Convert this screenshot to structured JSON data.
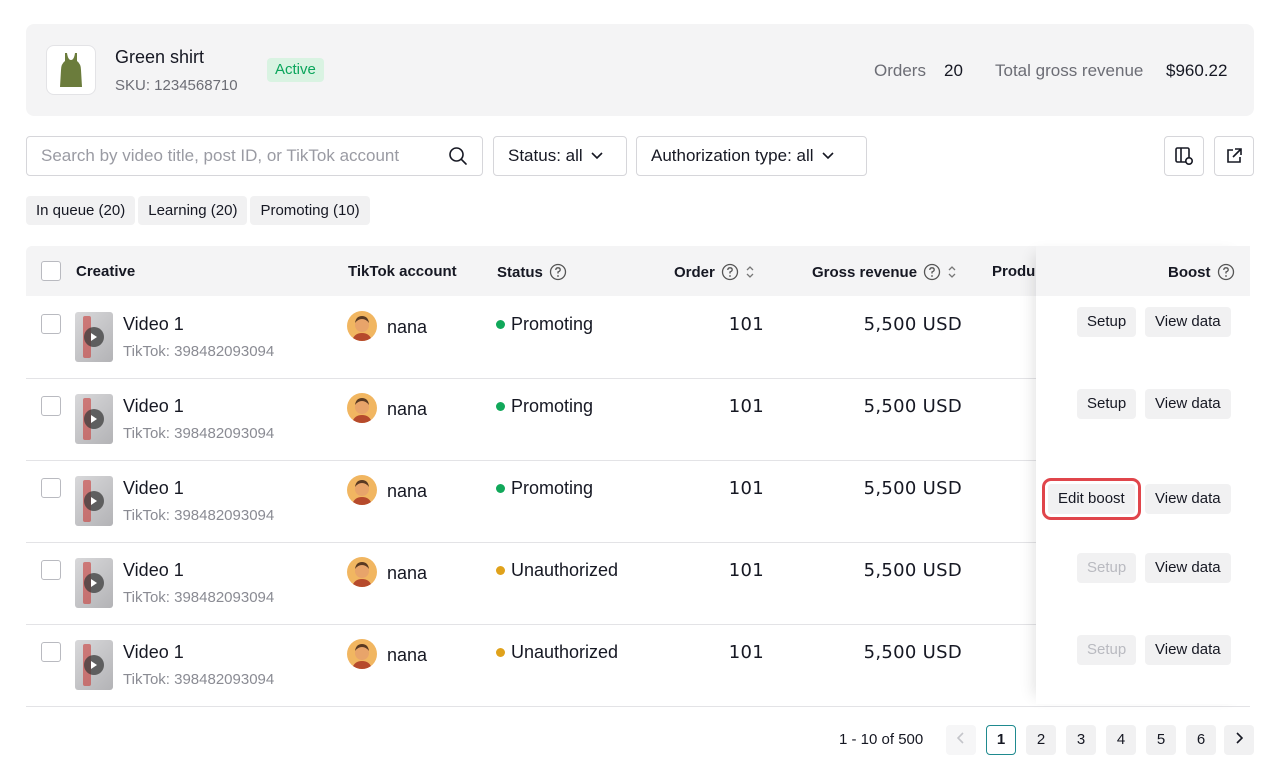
{
  "product": {
    "name": "Green shirt",
    "sku": "SKU: 1234568710",
    "status": "Active",
    "orders_label": "Orders",
    "orders_value": "20",
    "revenue_label": "Total gross revenue",
    "revenue_value": "$960.22"
  },
  "toolbar": {
    "search_placeholder": "Search by video title, post ID, or TikTok account",
    "status_filter": "Status: all",
    "auth_filter": "Authorization type: all"
  },
  "tabs": [
    "In queue (20)",
    "Learning (20)",
    "Promoting (10)"
  ],
  "columns": {
    "creative": "Creative",
    "account": "TikTok account",
    "status": "Status",
    "order": "Order",
    "revenue": "Gross revenue",
    "product": "Produ",
    "boost": "Boost"
  },
  "rows": [
    {
      "title": "Video 1",
      "sub": "TikTok: 398482093094",
      "account": "nana",
      "status": "Promoting",
      "order": "101",
      "revenue": "5,500 USD",
      "boost": "Setup",
      "view": "View data"
    },
    {
      "title": "Video 1",
      "sub": "TikTok: 398482093094",
      "account": "nana",
      "status": "Promoting",
      "order": "101",
      "revenue": "5,500 USD",
      "boost": "Setup",
      "view": "View data"
    },
    {
      "title": "Video 1",
      "sub": "TikTok: 398482093094",
      "account": "nana",
      "status": "Promoting",
      "order": "101",
      "revenue": "5,500 USD",
      "boost": "Edit boost",
      "view": "View data"
    },
    {
      "title": "Video 1",
      "sub": "TikTok: 398482093094",
      "account": "nana",
      "status": "Unauthorized",
      "order": "101",
      "revenue": "5,500 USD",
      "boost": "Setup",
      "view": "View data"
    },
    {
      "title": "Video 1",
      "sub": "TikTok: 398482093094",
      "account": "nana",
      "status": "Unauthorized",
      "order": "101",
      "revenue": "5,500 USD",
      "boost": "Setup",
      "view": "View data"
    }
  ],
  "colors": {
    "promoting": "#11a85a",
    "unauthorized": "#e0a21b",
    "active_page": "#1f8a8f",
    "highlight": "#e0454b"
  },
  "pagination": {
    "info": "1 - 10 of 500",
    "pages": [
      "1",
      "2",
      "3",
      "4",
      "5",
      "6"
    ],
    "current": "1"
  }
}
